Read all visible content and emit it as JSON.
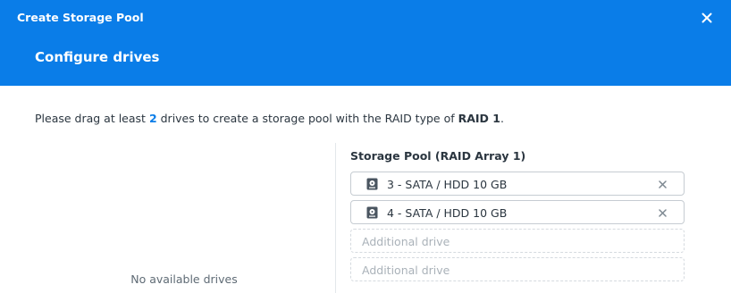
{
  "window": {
    "title": "Create Storage Pool",
    "close_icon": "close-icon"
  },
  "step": {
    "title": "Configure drives"
  },
  "instruction": {
    "prefix": "Please drag at least ",
    "count": "2",
    "middle": " drives to create a storage pool with the RAID type of ",
    "raid_type": "RAID 1",
    "suffix": "."
  },
  "available": {
    "empty_text": "No available drives"
  },
  "pool": {
    "title": "Storage Pool (RAID Array 1)",
    "drives": [
      {
        "label": "3 - SATA / HDD 10 GB",
        "icon": "hdd-icon",
        "remove_icon": "close-icon"
      },
      {
        "label": "4 - SATA / HDD 10 GB",
        "icon": "hdd-icon",
        "remove_icon": "close-icon"
      }
    ],
    "empty_slots": [
      {
        "placeholder": "Additional drive"
      },
      {
        "placeholder": "Additional drive"
      }
    ]
  },
  "colors": {
    "header_bg": "#0a7de8",
    "accent": "#0a7de8"
  }
}
